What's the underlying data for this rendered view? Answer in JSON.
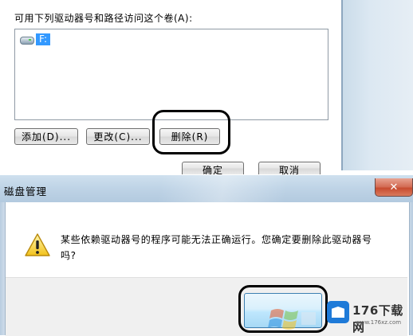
{
  "top_dialog": {
    "list_label": "可用下列驱动器号和路径访问这个卷(A):",
    "drive_item": "F:",
    "buttons": {
      "add": "添加(D)...",
      "change": "更改(C)...",
      "delete": "删除(R)",
      "ok": "确定",
      "cancel": "取消"
    }
  },
  "bottom_dialog": {
    "title": "磁盘管理",
    "close_glyph": "✕",
    "message_line1": "某些依赖驱动器号的程序可能无法正确运行。您确定要删除此驱动器号",
    "message_line2": "吗?",
    "ok_label": ""
  },
  "watermark": {
    "site_text": "176下载网",
    "site_url": "www.176xz.com"
  },
  "icons": {
    "warning": "warning-icon",
    "drive": "drive-icon",
    "close": "close-icon"
  },
  "colors": {
    "selection": "#3399ff",
    "titlebar": "#bed3e6",
    "highlight_ring": "#000000",
    "close_button": "#c74b2f"
  }
}
